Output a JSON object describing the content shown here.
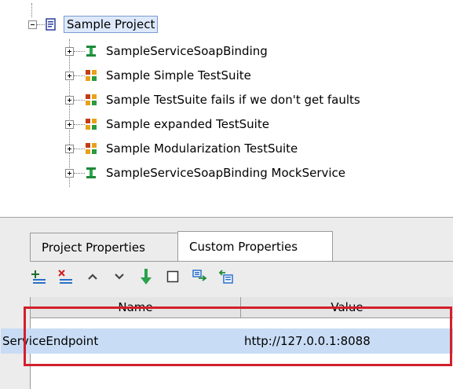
{
  "tree": {
    "project": "Sample Project",
    "items": [
      {
        "label": "SampleServiceSoapBinding",
        "icon": "interface-icon"
      },
      {
        "label": "Sample Simple TestSuite",
        "icon": "testsuite-icon"
      },
      {
        "label": "Sample TestSuite fails if we don't get faults",
        "icon": "testsuite-icon"
      },
      {
        "label": "Sample expanded TestSuite",
        "icon": "testsuite-icon"
      },
      {
        "label": "Sample Modularization TestSuite",
        "icon": "testsuite-icon"
      },
      {
        "label": "SampleServiceSoapBinding MockService",
        "icon": "mockservice-icon"
      }
    ]
  },
  "tabs": {
    "project_properties": "Project Properties",
    "custom_properties": "Custom Properties"
  },
  "table": {
    "headers": [
      "Name",
      "Value"
    ],
    "rows": [
      {
        "name": "ServiceEndpoint",
        "value": "http://127.0.0.1:8088"
      }
    ]
  },
  "colors": {
    "selection_bg": "#c8dcf5",
    "highlight_border": "#d21f2b"
  }
}
